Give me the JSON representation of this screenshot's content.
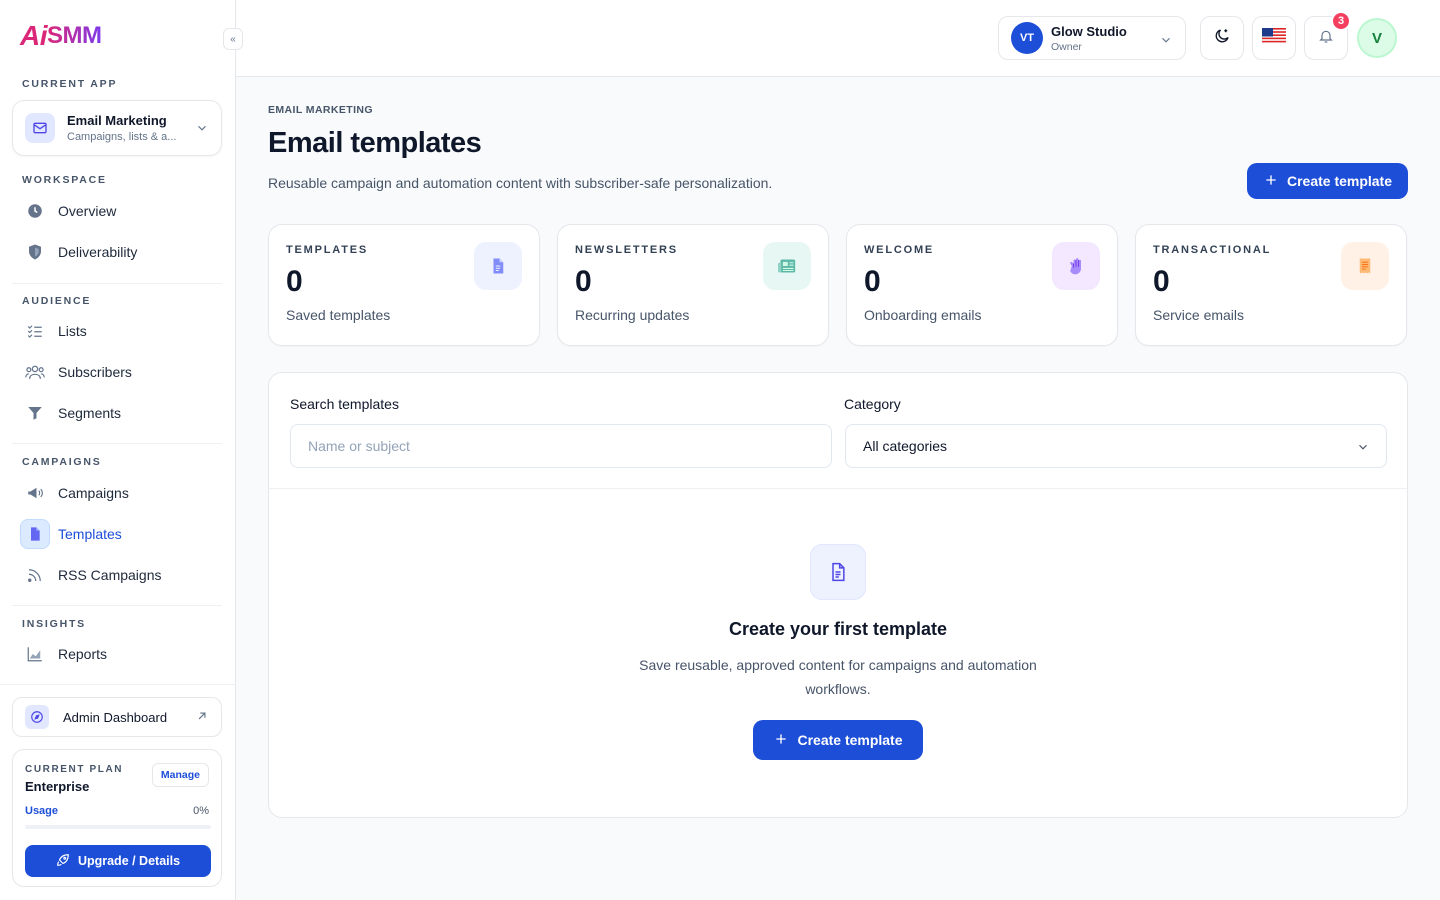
{
  "brand": {
    "ai": "Ai",
    "smm": "SMM"
  },
  "sidebar": {
    "current_app_label": "CURRENT APP",
    "app": {
      "title": "Email Marketing",
      "subtitle": "Campaigns, lists & a..."
    },
    "sections": {
      "workspace": "WORKSPACE",
      "audience": "AUDIENCE",
      "campaigns": "CAMPAIGNS",
      "insights": "INSIGHTS"
    },
    "items": {
      "overview": "Overview",
      "deliverability": "Deliverability",
      "lists": "Lists",
      "subscribers": "Subscribers",
      "segments": "Segments",
      "campaigns": "Campaigns",
      "templates": "Templates",
      "rss": "RSS Campaigns",
      "reports": "Reports"
    },
    "active_item": "templates",
    "admin_dashboard": "Admin Dashboard",
    "plan": {
      "label": "CURRENT PLAN",
      "name": "Enterprise",
      "manage": "Manage",
      "usage_label": "Usage",
      "usage_value": "0%",
      "usage_fraction": 0,
      "upgrade": "Upgrade / Details"
    }
  },
  "topbar": {
    "org": {
      "initials": "VT",
      "name": "Glow Studio",
      "role": "Owner"
    },
    "notifications_count": "3",
    "user_initial": "V"
  },
  "page": {
    "breadcrumb": "EMAIL MARKETING",
    "title": "Email templates",
    "subtitle": "Reusable campaign and automation content with subscriber-safe personalization.",
    "create_button": "Create template"
  },
  "stats": [
    {
      "label": "TEMPLATES",
      "value": "0",
      "desc": "Saved templates",
      "icon": "document-icon",
      "color": "#6366f1",
      "bg": "#eef2ff"
    },
    {
      "label": "NEWSLETTERS",
      "value": "0",
      "desc": "Recurring updates",
      "icon": "newspaper-icon",
      "color": "#0d9488",
      "bg": "#e6f7f4"
    },
    {
      "label": "WELCOME",
      "value": "0",
      "desc": "Onboarding emails",
      "icon": "hand-wave-icon",
      "color": "#7c3aed",
      "bg": "#f3e8ff"
    },
    {
      "label": "TRANSACTIONAL",
      "value": "0",
      "desc": "Service emails",
      "icon": "receipt-icon",
      "color": "#f97316",
      "bg": "#fff1e6"
    }
  ],
  "filters": {
    "search_label": "Search templates",
    "search_placeholder": "Name or subject",
    "search_value": "",
    "category_label": "Category",
    "category_value": "All categories"
  },
  "empty_state": {
    "title": "Create your first template",
    "description": "Save reusable, approved content for campaigns and automation workflows.",
    "button": "Create template"
  },
  "colors": {
    "accent": "#1d4ed8",
    "badge": "#f43f5e"
  }
}
